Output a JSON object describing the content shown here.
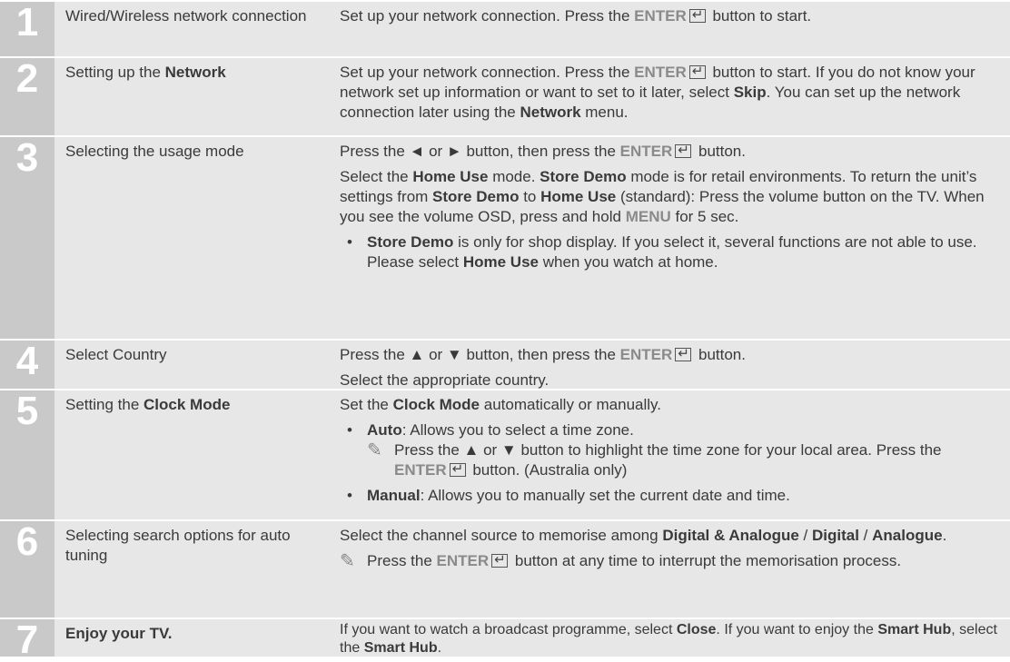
{
  "steps": [
    {
      "num": "1",
      "title": "Wired/Wireless network connection",
      "d1a": "Set up your network connection. Press the ",
      "enter": "ENTER",
      "d1b": " button to start."
    },
    {
      "num": "2",
      "title_a": "Setting up the ",
      "title_b": "Network",
      "p_a": "Set up your network connection. Press the ",
      "enter": "ENTER",
      "p_b": " button to start. If you do not know your network set up information or want to set to it later, select ",
      "skip": "Skip",
      "p_c": ". You can set up the network connection later using the ",
      "network": "Network",
      "p_d": " menu."
    },
    {
      "num": "3",
      "title": "Selecting the usage mode",
      "p1a": "Press the ◄ or ► button, then press the ",
      "enter": "ENTER",
      "p1b": " button.",
      "p2a": "Select the ",
      "home_use": "Home Use",
      "p2b": " mode. ",
      "store_demo": "Store Demo",
      "p2c": " mode is for retail environments. To return the unit’s settings from ",
      "p2d": " to ",
      "p2e": " (standard): Press the volume button on the TV. When you see the volume OSD, press and hold ",
      "menu": "MENU",
      "p2f": " for 5 sec.",
      "bullet_dot": "•",
      "b_a": " is only for shop display. If you select it, several functions are not able to use. Please select ",
      "b_b": " when you watch at home."
    },
    {
      "num": "4",
      "title": "Select Country",
      "p1a": "Press the ▲ or ▼ button, then press the ",
      "enter": "ENTER",
      "p1b": " button.",
      "p2": "Select the appropriate country."
    },
    {
      "num": "5",
      "title_a": "Setting the ",
      "title_b": "Clock Mode",
      "p1a": "Set the ",
      "clock_mode": "Clock Mode",
      "p1b": " automatically or manually.",
      "bullet_dot": "•",
      "auto": "Auto",
      "auto_desc": ": Allows you to select a time zone.",
      "note_a": "Press the ▲ or ▼ button to highlight the time zone for your local area. Press the ",
      "enter": "ENTER",
      "note_b": " button. (Australia only)",
      "manual": "Manual",
      "manual_desc": ": Allows you to manually set the current date and time."
    },
    {
      "num": "6",
      "title": "Selecting search options for auto tuning",
      "p1a": "Select the channel source to memorise among ",
      "dig_ana": "Digital & Analogue",
      "sep": " / ",
      "digital": "Digital",
      "analogue": "Analogue",
      "p1b": ".",
      "note_a": "Press the ",
      "enter": "ENTER",
      "note_b": " button at any time to interrupt the memorisation process."
    },
    {
      "num": "7",
      "title": "Enjoy your TV.",
      "p1a": "If you want to watch a broadcast programme, select ",
      "close": "Close",
      "p1b": ". If you want to enjoy the ",
      "smart_hub": "Smart Hub",
      "p1c": ", select the ",
      "p1d": "."
    }
  ],
  "icons": {
    "enter_icon": "enter-icon",
    "pencil_note_icon": "pencil-note-icon"
  },
  "colors": {
    "number_cell": "#c9c9c9",
    "content_cell": "#e7e7e7",
    "button_text": "#8a8a8a"
  }
}
